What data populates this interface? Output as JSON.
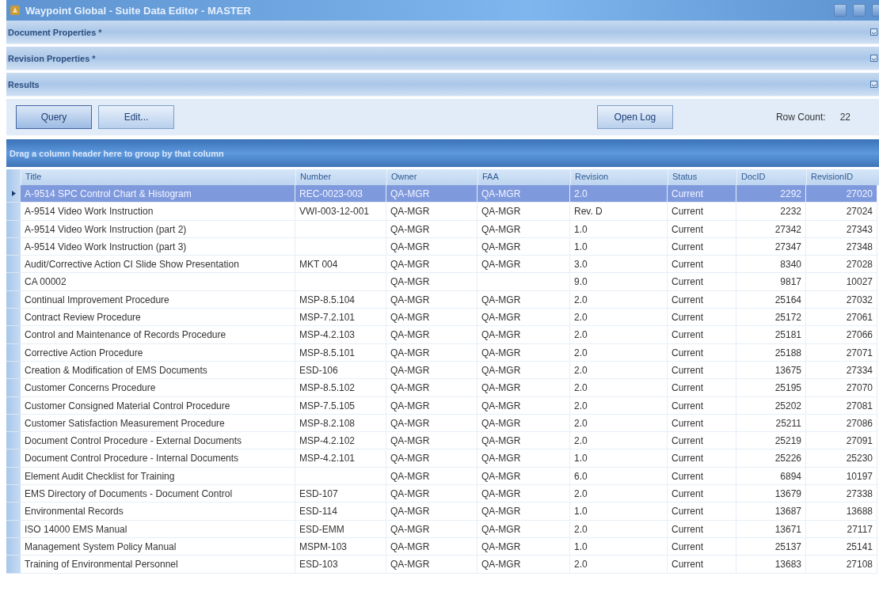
{
  "window": {
    "title": "Waypoint Global - Suite Data Editor - MASTER"
  },
  "panels": [
    {
      "title": "Document Properties *"
    },
    {
      "title": "Revision Properties *"
    },
    {
      "title": "Results"
    }
  ],
  "toolbar": {
    "buttons": [
      "Query",
      "Edit..."
    ],
    "log_button": "Open Log",
    "row_count_label": "Row Count:",
    "row_count": "22"
  },
  "group_hint": "Drag a column header here to group by that column",
  "table": {
    "columns": [
      {
        "label": "Title",
        "kind": "text"
      },
      {
        "label": "Number",
        "kind": "text"
      },
      {
        "label": "Owner",
        "kind": "text"
      },
      {
        "label": "FAA",
        "kind": "text"
      },
      {
        "label": "Revision",
        "kind": "text"
      },
      {
        "label": "Status",
        "kind": "text"
      },
      {
        "label": "DocID",
        "kind": "number"
      },
      {
        "label": "RevisionID",
        "kind": "number"
      }
    ],
    "rows": [
      {
        "selected": true,
        "cells": [
          "A-9514 SPC Control Chart & Histogram",
          "REC-0023-003",
          "QA-MGR",
          "QA-MGR",
          "2.0",
          "Current",
          "2292",
          "27020"
        ]
      },
      {
        "selected": false,
        "cells": [
          "A-9514 Video Work Instruction",
          "VWI-003-12-001",
          "QA-MGR",
          "QA-MGR",
          "Rev. D",
          "Current",
          "2232",
          "27024"
        ]
      },
      {
        "selected": false,
        "cells": [
          "A-9514 Video Work Instruction (part 2)",
          "",
          "QA-MGR",
          "QA-MGR",
          "1.0",
          "Current",
          "27342",
          "27343"
        ]
      },
      {
        "selected": false,
        "cells": [
          "A-9514 Video Work Instruction (part 3)",
          "",
          "QA-MGR",
          "QA-MGR",
          "1.0",
          "Current",
          "27347",
          "27348"
        ]
      },
      {
        "selected": false,
        "cells": [
          "Audit/Corrective Action CI Slide Show Presentation",
          "MKT 004",
          "QA-MGR",
          "QA-MGR",
          "3.0",
          "Current",
          "8340",
          "27028"
        ]
      },
      {
        "selected": false,
        "cells": [
          "CA 00002",
          "",
          "QA-MGR",
          "",
          "9.0",
          "Current",
          "9817",
          "10027"
        ]
      },
      {
        "selected": false,
        "cells": [
          "Continual Improvement Procedure",
          "MSP-8.5.104",
          "QA-MGR",
          "QA-MGR",
          "2.0",
          "Current",
          "25164",
          "27032"
        ]
      },
      {
        "selected": false,
        "cells": [
          "Contract Review Procedure",
          "MSP-7.2.101",
          "QA-MGR",
          "QA-MGR",
          "2.0",
          "Current",
          "25172",
          "27061"
        ]
      },
      {
        "selected": false,
        "cells": [
          "Control and Maintenance of Records Procedure",
          "MSP-4.2.103",
          "QA-MGR",
          "QA-MGR",
          "2.0",
          "Current",
          "25181",
          "27066"
        ]
      },
      {
        "selected": false,
        "cells": [
          "Corrective Action Procedure",
          "MSP-8.5.101",
          "QA-MGR",
          "QA-MGR",
          "2.0",
          "Current",
          "25188",
          "27071"
        ]
      },
      {
        "selected": false,
        "cells": [
          "Creation & Modification of EMS Documents",
          "ESD-106",
          "QA-MGR",
          "QA-MGR",
          "2.0",
          "Current",
          "13675",
          "27334"
        ]
      },
      {
        "selected": false,
        "cells": [
          "Customer Concerns Procedure",
          "MSP-8.5.102",
          "QA-MGR",
          "QA-MGR",
          "2.0",
          "Current",
          "25195",
          "27070"
        ]
      },
      {
        "selected": false,
        "cells": [
          "Customer Consigned Material Control Procedure",
          "MSP-7.5.105",
          "QA-MGR",
          "QA-MGR",
          "2.0",
          "Current",
          "25202",
          "27081"
        ]
      },
      {
        "selected": false,
        "cells": [
          "Customer Satisfaction Measurement Procedure",
          "MSP-8.2.108",
          "QA-MGR",
          "QA-MGR",
          "2.0",
          "Current",
          "25211",
          "27086"
        ]
      },
      {
        "selected": false,
        "cells": [
          "Document Control Procedure - External Documents",
          "MSP-4.2.102",
          "QA-MGR",
          "QA-MGR",
          "2.0",
          "Current",
          "25219",
          "27091"
        ]
      },
      {
        "selected": false,
        "cells": [
          "Document Control Procedure - Internal Documents",
          "MSP-4.2.101",
          "QA-MGR",
          "QA-MGR",
          "1.0",
          "Current",
          "25226",
          "25230"
        ]
      },
      {
        "selected": false,
        "cells": [
          "Element Audit Checklist for Training",
          "",
          "QA-MGR",
          "QA-MGR",
          "6.0",
          "Current",
          "6894",
          "10197"
        ]
      },
      {
        "selected": false,
        "cells": [
          "EMS Directory of Documents - Document Control",
          "ESD-107",
          "QA-MGR",
          "QA-MGR",
          "2.0",
          "Current",
          "13679",
          "27338"
        ]
      },
      {
        "selected": false,
        "cells": [
          "Environmental Records",
          "ESD-114",
          "QA-MGR",
          "QA-MGR",
          "1.0",
          "Current",
          "13687",
          "13688"
        ]
      },
      {
        "selected": false,
        "cells": [
          "ISO 14000 EMS Manual",
          "ESD-EMM",
          "QA-MGR",
          "QA-MGR",
          "2.0",
          "Current",
          "13671",
          "27117"
        ]
      },
      {
        "selected": false,
        "cells": [
          "Management System Policy Manual",
          "MSPM-103",
          "QA-MGR",
          "QA-MGR",
          "1.0",
          "Current",
          "25137",
          "25141"
        ]
      },
      {
        "selected": false,
        "cells": [
          "Training of Environmental Personnel",
          "ESD-103",
          "QA-MGR",
          "QA-MGR",
          "2.0",
          "Current",
          "13683",
          "27108"
        ]
      }
    ]
  }
}
